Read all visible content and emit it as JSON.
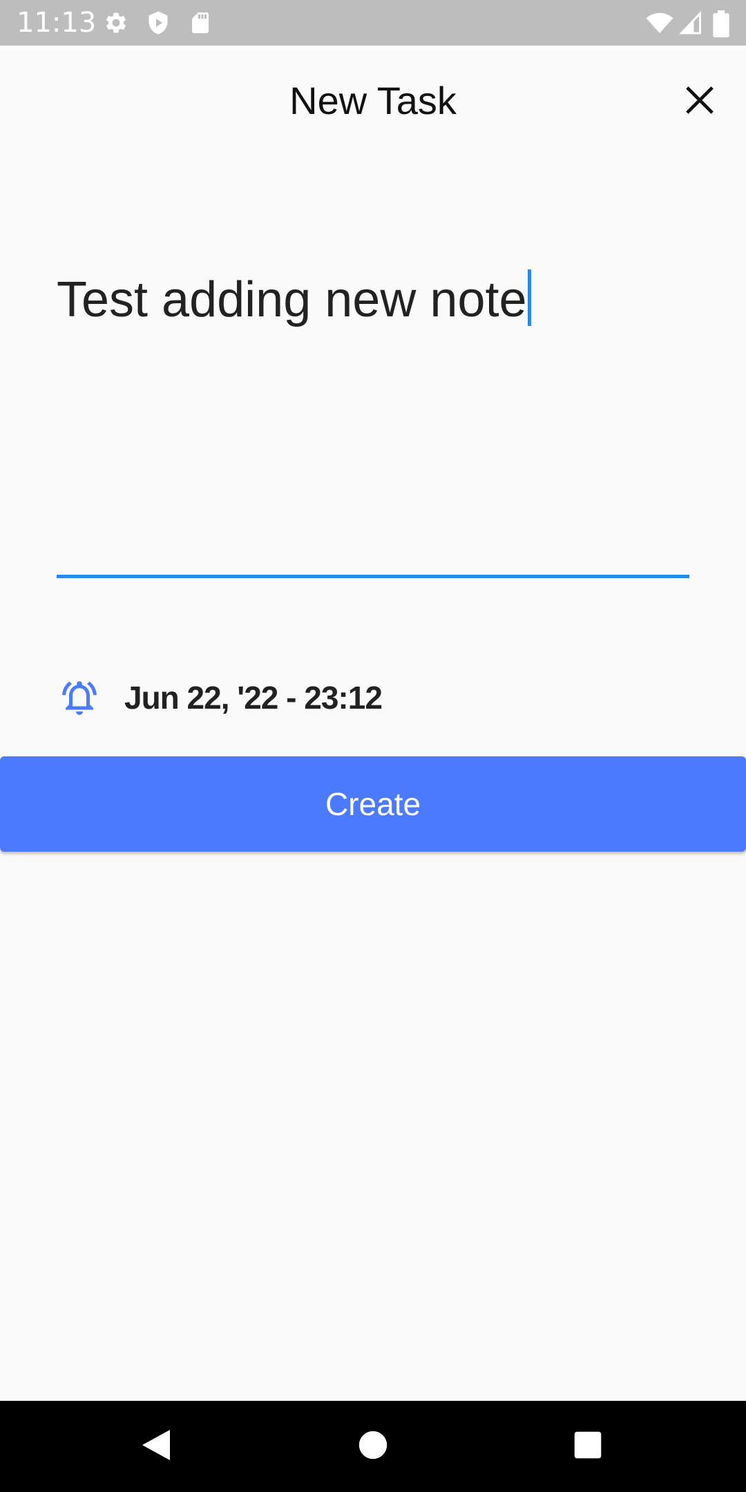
{
  "status_bar": {
    "time": "11:13",
    "left_icons": [
      "settings-icon",
      "shield-play-icon",
      "sd-card-icon"
    ],
    "right_icons": [
      "wifi-icon",
      "cellular-signal-icon",
      "battery-icon"
    ]
  },
  "header": {
    "title": "New Task",
    "close_icon": "close-icon"
  },
  "task_input": {
    "value": "Test adding new note",
    "accent_color": "#2a8be0"
  },
  "reminder": {
    "icon": "alarm-bell-icon",
    "datetime": "Jun 22, '22 - 23:12",
    "icon_color": "#4b7bfc"
  },
  "create_button": {
    "label": "Create",
    "color": "#4b7bfc"
  },
  "nav_bar": {
    "buttons": [
      "back-icon",
      "home-icon",
      "recents-icon"
    ]
  }
}
